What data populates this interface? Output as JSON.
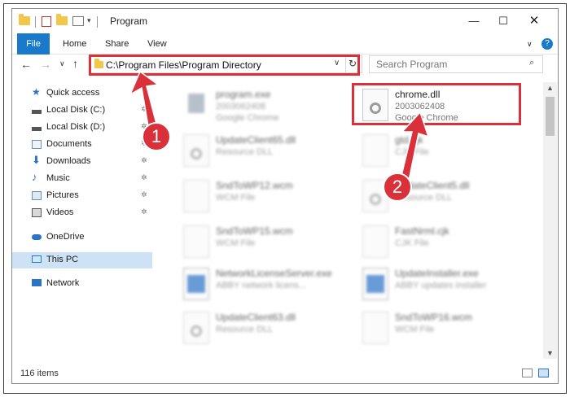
{
  "window": {
    "title": "Program"
  },
  "ribbon": {
    "tabs": [
      "File",
      "Home",
      "Share",
      "View"
    ]
  },
  "address": {
    "path": "C:\\Program Files\\Program Directory"
  },
  "search": {
    "placeholder": "Search Program"
  },
  "sidebar": {
    "items": [
      {
        "label": "Quick access",
        "icon": "star-icon",
        "pinned": false
      },
      {
        "label": "Local Disk (C:)",
        "icon": "drive-icon",
        "pinned": true
      },
      {
        "label": "Local Disk (D:)",
        "icon": "drive-icon",
        "pinned": true
      },
      {
        "label": "Documents",
        "icon": "documents-icon",
        "pinned": true
      },
      {
        "label": "Downloads",
        "icon": "download-icon",
        "pinned": true
      },
      {
        "label": "Music",
        "icon": "music-icon",
        "pinned": true
      },
      {
        "label": "Pictures",
        "icon": "pictures-icon",
        "pinned": true
      },
      {
        "label": "Videos",
        "icon": "videos-icon",
        "pinned": true
      },
      {
        "label": "OneDrive",
        "icon": "cloud-icon",
        "pinned": false
      },
      {
        "label": "This PC",
        "icon": "computer-icon",
        "pinned": false,
        "selected": true
      },
      {
        "label": "Network",
        "icon": "network-icon",
        "pinned": false
      }
    ]
  },
  "files": [
    {
      "name": "program.exe",
      "line2": "2003062408",
      "line3": "Google Chrome",
      "icon": "exe-icon",
      "blurred": true
    },
    {
      "name": "chrome.dll",
      "line2": "2003062408",
      "line3": "Google Chrome",
      "icon": "dll-icon",
      "blurred": false
    },
    {
      "name": "UpdateClient65.dll",
      "line2": "Resource DLL",
      "line3": "",
      "icon": "dll-icon",
      "blurred": true
    },
    {
      "name": "gtd.cjk",
      "line2": "CJK File",
      "line3": "",
      "icon": "file-icon",
      "blurred": true
    },
    {
      "name": "SndToWP12.wcm",
      "line2": "WCM File",
      "line3": "",
      "icon": "file-icon",
      "blurred": true
    },
    {
      "name": "UpdateClient5.dll",
      "line2": "Resource DLL",
      "line3": "",
      "icon": "dll-icon",
      "blurred": true
    },
    {
      "name": "SndToWP15.wcm",
      "line2": "WCM File",
      "line3": "",
      "icon": "file-icon",
      "blurred": true
    },
    {
      "name": "FastNrml.cjk",
      "line2": "CJK File",
      "line3": "",
      "icon": "file-icon",
      "blurred": true
    },
    {
      "name": "NetworkLicenseServer.exe",
      "line2": "ABBY network licens...",
      "line3": "",
      "icon": "app-icon",
      "blurred": true
    },
    {
      "name": "UpdateInstaller.exe",
      "line2": "ABBY updates installer",
      "line3": "",
      "icon": "app-icon",
      "blurred": true
    },
    {
      "name": "UpdateClient63.dll",
      "line2": "Resource DLL",
      "line3": "",
      "icon": "dll-icon",
      "blurred": true
    },
    {
      "name": "SndToWP16.wcm",
      "line2": "WCM File",
      "line3": "",
      "icon": "file-icon",
      "blurred": true
    }
  ],
  "status": {
    "count": "116 items"
  },
  "annotations": {
    "badge1": "1",
    "badge2": "2",
    "color": "#d9303a"
  },
  "colors": {
    "accent": "#1979ca",
    "selected": "#cde3f5"
  }
}
